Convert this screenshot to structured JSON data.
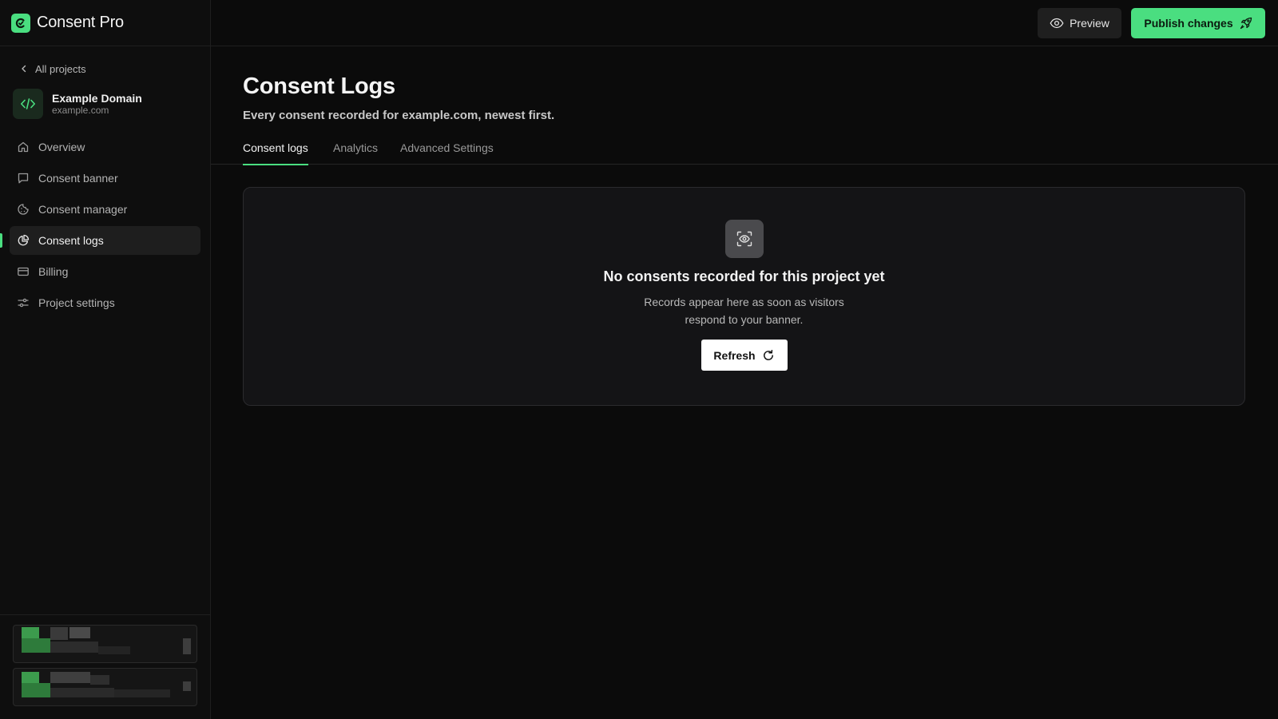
{
  "app": {
    "name": "Consent Pro"
  },
  "sidebar": {
    "back_label": "All projects",
    "project": {
      "name": "Example Domain",
      "url": "example.com"
    },
    "items": [
      {
        "label": "Overview",
        "icon": "home-icon",
        "active": false
      },
      {
        "label": "Consent banner",
        "icon": "chat-bubble-icon",
        "active": false
      },
      {
        "label": "Consent manager",
        "icon": "cookie-icon",
        "active": false
      },
      {
        "label": "Consent logs",
        "icon": "pie-chart-icon",
        "active": true
      },
      {
        "label": "Billing",
        "icon": "credit-card-icon",
        "active": false
      },
      {
        "label": "Project settings",
        "icon": "sliders-icon",
        "active": false
      }
    ]
  },
  "topbar": {
    "preview_label": "Preview",
    "publish_label": "Publish changes"
  },
  "page": {
    "title": "Consent Logs",
    "subtitle": "Every consent recorded for example.com, newest first.",
    "tabs": [
      {
        "label": "Consent logs",
        "active": true
      },
      {
        "label": "Analytics",
        "active": false
      },
      {
        "label": "Advanced Settings",
        "active": false
      }
    ]
  },
  "empty_state": {
    "icon": "scan-eye-icon",
    "title": "No consents recorded for this project yet",
    "description": "Records appear here as soon as visitors respond to your banner.",
    "button_label": "Refresh"
  },
  "colors": {
    "accent": "#4ade80",
    "background": "#0b0b0b",
    "card": "#141416"
  }
}
